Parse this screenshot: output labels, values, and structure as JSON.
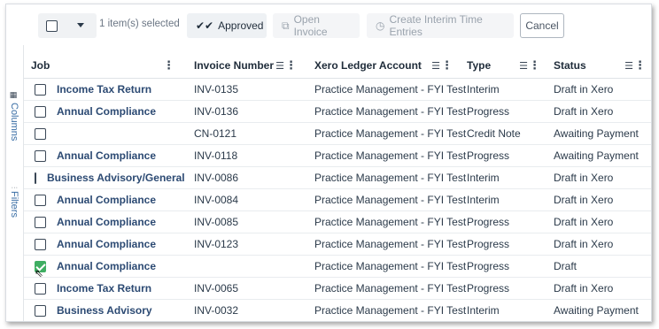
{
  "toolbar": {
    "selected_count": "1 item(s) selected",
    "approved_label": "Approved",
    "open_invoice_label": "Open Invoice",
    "create_interim_label": "Create Interim Time Entries",
    "cancel_label": "Cancel"
  },
  "side": {
    "columns_label": "Columns",
    "filters_label": "Filters"
  },
  "headers": {
    "job": "Job",
    "invoice": "Invoice Number",
    "account": "Xero Ledger Account",
    "type": "Type",
    "status": "Status"
  },
  "rows": [
    {
      "job": "Income Tax Return",
      "invoice": "INV-0135",
      "account": "Practice Management - FYI Test",
      "type": "Interim",
      "status": "Draft in Xero",
      "checked": false
    },
    {
      "job": "Annual Compliance",
      "invoice": "INV-0136",
      "account": "Practice Management - FYI Test",
      "type": "Progress",
      "status": "Draft in Xero",
      "checked": false
    },
    {
      "job": "",
      "invoice": "CN-0121",
      "account": "Practice Management - FYI Test",
      "type": "Credit Note",
      "status": "Awaiting Payment",
      "checked": false
    },
    {
      "job": "Annual Compliance",
      "invoice": "INV-0118",
      "account": "Practice Management - FYI Test",
      "type": "Progress",
      "status": "Awaiting Payment",
      "checked": false
    },
    {
      "job": "Business Advisory/General",
      "invoice": "INV-0086",
      "account": "Practice Management - FYI Test",
      "type": "Interim",
      "status": "Draft in Xero",
      "checked": false
    },
    {
      "job": "Annual Compliance",
      "invoice": "INV-0084",
      "account": "Practice Management - FYI Test",
      "type": "Interim",
      "status": "Draft in Xero",
      "checked": false
    },
    {
      "job": "Annual Compliance",
      "invoice": "INV-0085",
      "account": "Practice Management - FYI Test",
      "type": "Progress",
      "status": "Draft in Xero",
      "checked": false
    },
    {
      "job": "Annual Compliance",
      "invoice": "INV-0123",
      "account": "Practice Management - FYI Test",
      "type": "Progress",
      "status": "Draft in Xero",
      "checked": false
    },
    {
      "job": "Annual Compliance",
      "invoice": "",
      "account": "Practice Management - FYI Test",
      "type": "Progress",
      "status": "Draft",
      "checked": true
    },
    {
      "job": "Income Tax Return",
      "invoice": "INV-0065",
      "account": "Practice Management - FYI Test",
      "type": "Progress",
      "status": "Draft in Xero",
      "checked": false
    },
    {
      "job": "Business Advisory",
      "invoice": "INV-0032",
      "account": "Practice Management - FYI Test",
      "type": "Interim",
      "status": "Awaiting Payment",
      "checked": false
    }
  ],
  "icons": {
    "approved": "double-check-icon",
    "open_invoice": "external-link-icon",
    "create_interim": "clock-icon",
    "columns": "grid-icon",
    "filters": "filter-icon"
  },
  "colors": {
    "checked": "#3fae62",
    "job_text": "#2c4a73",
    "side_label": "#3a6ea5"
  }
}
